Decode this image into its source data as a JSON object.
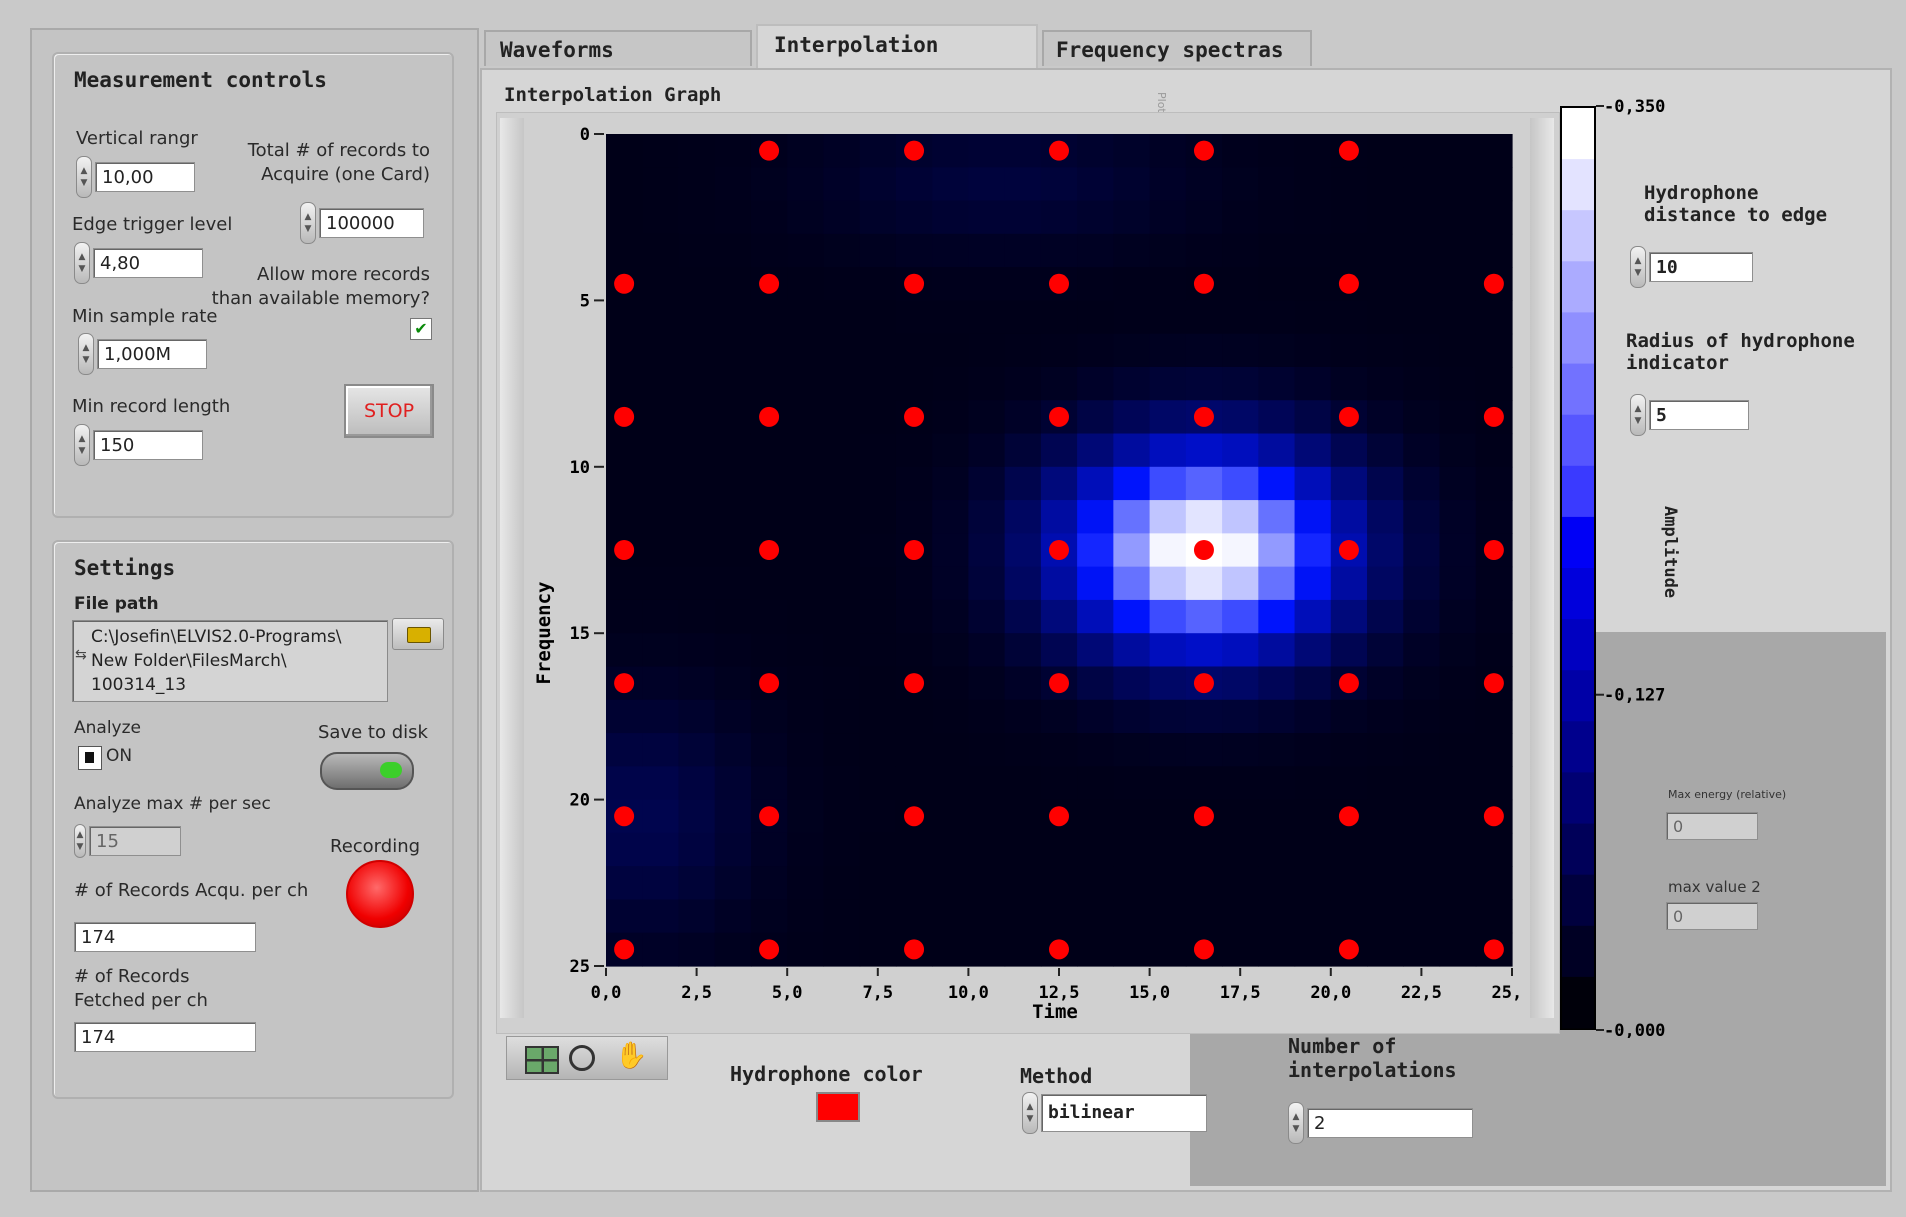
{
  "measurement": {
    "title": "Measurement controls",
    "vertical_range_label": "Vertical rangr",
    "vertical_range_value": "10,00",
    "total_records_label_1": "Total # of records to",
    "total_records_label_2": "Acquire (one Card)",
    "total_records_value": "100000",
    "edge_trigger_label": "Edge trigger level",
    "edge_trigger_value": "4,80",
    "allow_more_label_1": "Allow more records",
    "allow_more_label_2": "than available memory?",
    "allow_more_checked": true,
    "min_sample_rate_label": "Min sample rate",
    "min_sample_rate_value": "1,000M",
    "min_record_length_label": "Min record length",
    "min_record_length_value": "150",
    "stop_label": "STOP"
  },
  "settings": {
    "title": "Settings",
    "file_path_label": "File path",
    "file_path_lines": [
      "C:\\Josefin\\ELVIS2.0-Programs\\",
      "New Folder\\FilesMarch\\",
      "100314_13"
    ],
    "analyze_label": "Analyze",
    "analyze_state": "ON",
    "save_to_disk_label": "Save to disk",
    "analyze_max_label": "Analyze max # per sec",
    "analyze_max_value": "15",
    "recording_label": "Recording",
    "records_acq_label": "# of Records Acqu. per ch",
    "records_acq_value": "174",
    "records_fetched_label_1": "# of Records",
    "records_fetched_label_2": "Fetched per ch",
    "records_fetched_value": "174"
  },
  "tabs": [
    "Waveforms",
    "Interpolation",
    "Frequency spectras"
  ],
  "graph": {
    "title": "Interpolation Graph",
    "side_label": "Plot 0"
  },
  "chart_data": {
    "type": "heatmap",
    "xlabel": "Time",
    "ylabel": "Frequency",
    "xlim": [
      0,
      25
    ],
    "ylim": [
      0,
      25
    ],
    "x_ticks": [
      "0,0",
      "2,5",
      "5,0",
      "7,5",
      "10,0",
      "12,5",
      "15,0",
      "17,5",
      "20,0",
      "22,5",
      "25,0"
    ],
    "y_ticks": [
      "0",
      "5",
      "10",
      "15",
      "20",
      "25"
    ],
    "colorbar": {
      "label": "Amplitude",
      "ticks": [
        "0,350",
        "0,127",
        "0,000"
      ],
      "min": 0,
      "max": 0.35
    },
    "hydrophones": [
      [
        4.5,
        0.5
      ],
      [
        8.5,
        0.5
      ],
      [
        12.5,
        0.5
      ],
      [
        16.5,
        0.5
      ],
      [
        20.5,
        0.5
      ],
      [
        0.5,
        4.5
      ],
      [
        4.5,
        4.5
      ],
      [
        8.5,
        4.5
      ],
      [
        12.5,
        4.5
      ],
      [
        16.5,
        4.5
      ],
      [
        20.5,
        4.5
      ],
      [
        24.5,
        4.5
      ],
      [
        0.5,
        8.5
      ],
      [
        4.5,
        8.5
      ],
      [
        8.5,
        8.5
      ],
      [
        12.5,
        8.5
      ],
      [
        16.5,
        8.5
      ],
      [
        20.5,
        8.5
      ],
      [
        24.5,
        8.5
      ],
      [
        0.5,
        12.5
      ],
      [
        4.5,
        12.5
      ],
      [
        8.5,
        12.5
      ],
      [
        12.5,
        12.5
      ],
      [
        16.5,
        12.5
      ],
      [
        20.5,
        12.5
      ],
      [
        24.5,
        12.5
      ],
      [
        0.5,
        16.5
      ],
      [
        4.5,
        16.5
      ],
      [
        8.5,
        16.5
      ],
      [
        12.5,
        16.5
      ],
      [
        16.5,
        16.5
      ],
      [
        20.5,
        16.5
      ],
      [
        24.5,
        16.5
      ],
      [
        0.5,
        20.5
      ],
      [
        4.5,
        20.5
      ],
      [
        8.5,
        20.5
      ],
      [
        12.5,
        20.5
      ],
      [
        16.5,
        20.5
      ],
      [
        20.5,
        20.5
      ],
      [
        24.5,
        20.5
      ],
      [
        0.5,
        24.5
      ],
      [
        4.5,
        24.5
      ],
      [
        8.5,
        24.5
      ],
      [
        12.5,
        24.5
      ],
      [
        16.5,
        24.5
      ],
      [
        20.5,
        24.5
      ],
      [
        24.5,
        24.5
      ]
    ],
    "peak": {
      "x": 16.5,
      "y": 12.5
    }
  },
  "right": {
    "distance_label_1": "Hydrophone",
    "distance_label_2": "distance to edge",
    "distance_value": "10",
    "radius_label_1": "Radius of hydrophone",
    "radius_label_2": "indicator",
    "radius_value": "5",
    "max_energy_label": "Max energy (relative)",
    "max_energy_value": "0",
    "max_value2_label": "max value 2",
    "max_value2_value": "0"
  },
  "bottom": {
    "hydrophone_color_label": "Hydrophone color",
    "hydrophone_color": "#ff0000",
    "method_label": "Method",
    "method_value": "bilinear",
    "num_interp_label_1": "Number of",
    "num_interp_label_2": "interpolations",
    "num_interp_value": "2"
  }
}
